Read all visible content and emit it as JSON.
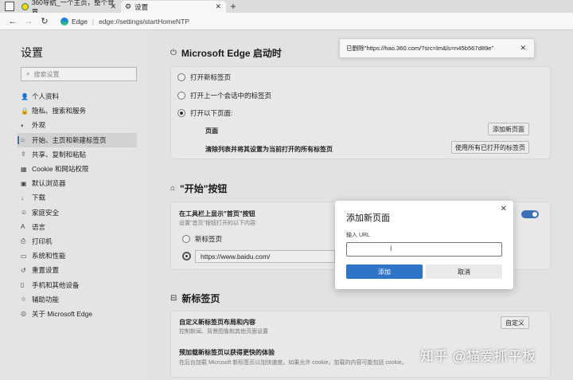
{
  "tabs": [
    {
      "title": "360导航_一个主页，整个世界",
      "active": false
    },
    {
      "title": "设置",
      "active": true
    }
  ],
  "toolbar": {
    "brand": "Edge",
    "separator": "|",
    "url": "edge://settings/startHomeNTP"
  },
  "sidebar": {
    "title": "设置",
    "search_placeholder": "搜索设置",
    "items": [
      {
        "icon": "person-icon",
        "glyph": "👤",
        "label": "个人资料"
      },
      {
        "icon": "lock-icon",
        "glyph": "🔒",
        "label": "隐私、搜索和服务"
      },
      {
        "icon": "appearance-icon",
        "glyph": "◐",
        "label": "外观"
      },
      {
        "icon": "start-icon",
        "glyph": "⌂",
        "label": "开始、主页和新建标签页"
      },
      {
        "icon": "share-icon",
        "glyph": "⇪",
        "label": "共享、复制和粘贴"
      },
      {
        "icon": "cookie-icon",
        "glyph": "▦",
        "label": "Cookie 和网站权限"
      },
      {
        "icon": "browser-icon",
        "glyph": "▣",
        "label": "默认浏览器"
      },
      {
        "icon": "download-icon",
        "glyph": "↓",
        "label": "下载"
      },
      {
        "icon": "family-icon",
        "glyph": "☺",
        "label": "家庭安全"
      },
      {
        "icon": "language-icon",
        "glyph": "A",
        "label": "语言"
      },
      {
        "icon": "printer-icon",
        "glyph": "⎙",
        "label": "打印机"
      },
      {
        "icon": "system-icon",
        "glyph": "▭",
        "label": "系统和性能"
      },
      {
        "icon": "reset-icon",
        "glyph": "↺",
        "label": "重置设置"
      },
      {
        "icon": "phone-icon",
        "glyph": "▯",
        "label": "手机和其他设备"
      },
      {
        "icon": "accessibility-icon",
        "glyph": "☆",
        "label": "辅助功能"
      },
      {
        "icon": "edge-icon",
        "glyph": "◎",
        "label": "关于 Microsoft Edge"
      }
    ]
  },
  "startup": {
    "title": "Microsoft Edge 启动时",
    "options": [
      "打开新标签页",
      "打开上一个会话中的标签页",
      "打开以下页面:"
    ],
    "pages_label": "页面",
    "add_page_button": "添加新页面",
    "clear_label": "清除列表并将其设置为当前打开的所有标签页",
    "use_open_tabs_button": "使用所有已打开的标签页"
  },
  "home_button": {
    "title": "\"开始\"按钮",
    "show_label": "在工具栏上显示\"首页\"按钮",
    "show_desc": "设置\"首页\"按钮打开的以下内容:",
    "newtab_option": "新标签页",
    "url_value": "https://www.baidu.com/"
  },
  "new_tab": {
    "title": "新标签页",
    "customize_label": "自定义新标签页布局和内容",
    "customize_desc": "控制新闻、背景图像和其他页面设置",
    "customize_button": "自定义",
    "preload_label": "预加载新标签页以获得更快的体验",
    "preload_desc": "在后台加载 Microsoft 新标签页以加快速度。如果允许 cookie，加载的内容可能包括 cookie。"
  },
  "toast": {
    "message": "已删除\"https://hao.360.com/?src=lm&ls=n45b567d89e\""
  },
  "dialog": {
    "title": "添加新页面",
    "url_label": "输入 URL",
    "url_value": "",
    "add_button": "添加",
    "cancel_button": "取消"
  },
  "watermark": "知乎 @猫爱抓平板",
  "colors": {
    "accent": "#2e75c9",
    "toggle_on": "#3b6fb6"
  }
}
